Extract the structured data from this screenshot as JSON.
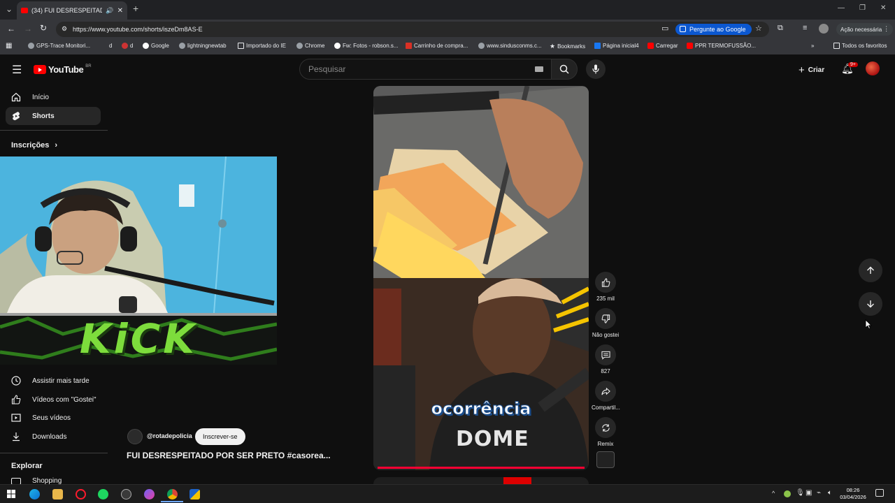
{
  "browser": {
    "tab_title": "(34) FUI DESRESPEITADO P",
    "new_tab": "+",
    "url": "https://www.youtube.com/shorts/iszeDm8AS-E",
    "ask_google": "Pergunte ao Google",
    "action_needed": "Ação necessária",
    "window_min": "—",
    "window_restore": "❐",
    "window_close": "✕"
  },
  "bookmarks": [
    "GPS-Trace Monitori...",
    "d",
    "d",
    "Google",
    "lightningnewtab",
    "Importado do IE",
    "Chrome",
    "Fw: Fotos - robson.s...",
    "Carrinho de compra...",
    "www.sindusconms.c...",
    "Bookmarks",
    "Página inicial4",
    "Carregar",
    "PPR TERMOFUSSÃO..."
  ],
  "all_bookmarks": "Todos os favoritos",
  "youtube": {
    "logo": "YouTube",
    "region": "BR",
    "search_placeholder": "Pesquisar",
    "create": "Criar",
    "notif_badge": "9+"
  },
  "sidebar": {
    "home": "Início",
    "shorts": "Shorts",
    "subscriptions": "Inscrições",
    "watch_later": "Assistir mais tarde",
    "liked": "Vídeos com \"Gostei\"",
    "your_videos": "Seus vídeos",
    "downloads": "Downloads",
    "explore": "Explorar",
    "shopping": "Shopping"
  },
  "overlay": {
    "kick_text": "KiCK"
  },
  "short": {
    "channel": "@rotadepolicia",
    "subscribe": "Inscrever-se",
    "title": "FUI DESRESPEITADO POR SER PRETO #casorea...",
    "caption": "ocorrência",
    "shirt_text": "DOME"
  },
  "actions": {
    "likes": "235 mil",
    "dislike": "Não gostei",
    "comments": "827",
    "share": "Compartil...",
    "remix": "Remix"
  },
  "taskbar": {
    "time": "08:26",
    "date": "03/04/2026"
  }
}
